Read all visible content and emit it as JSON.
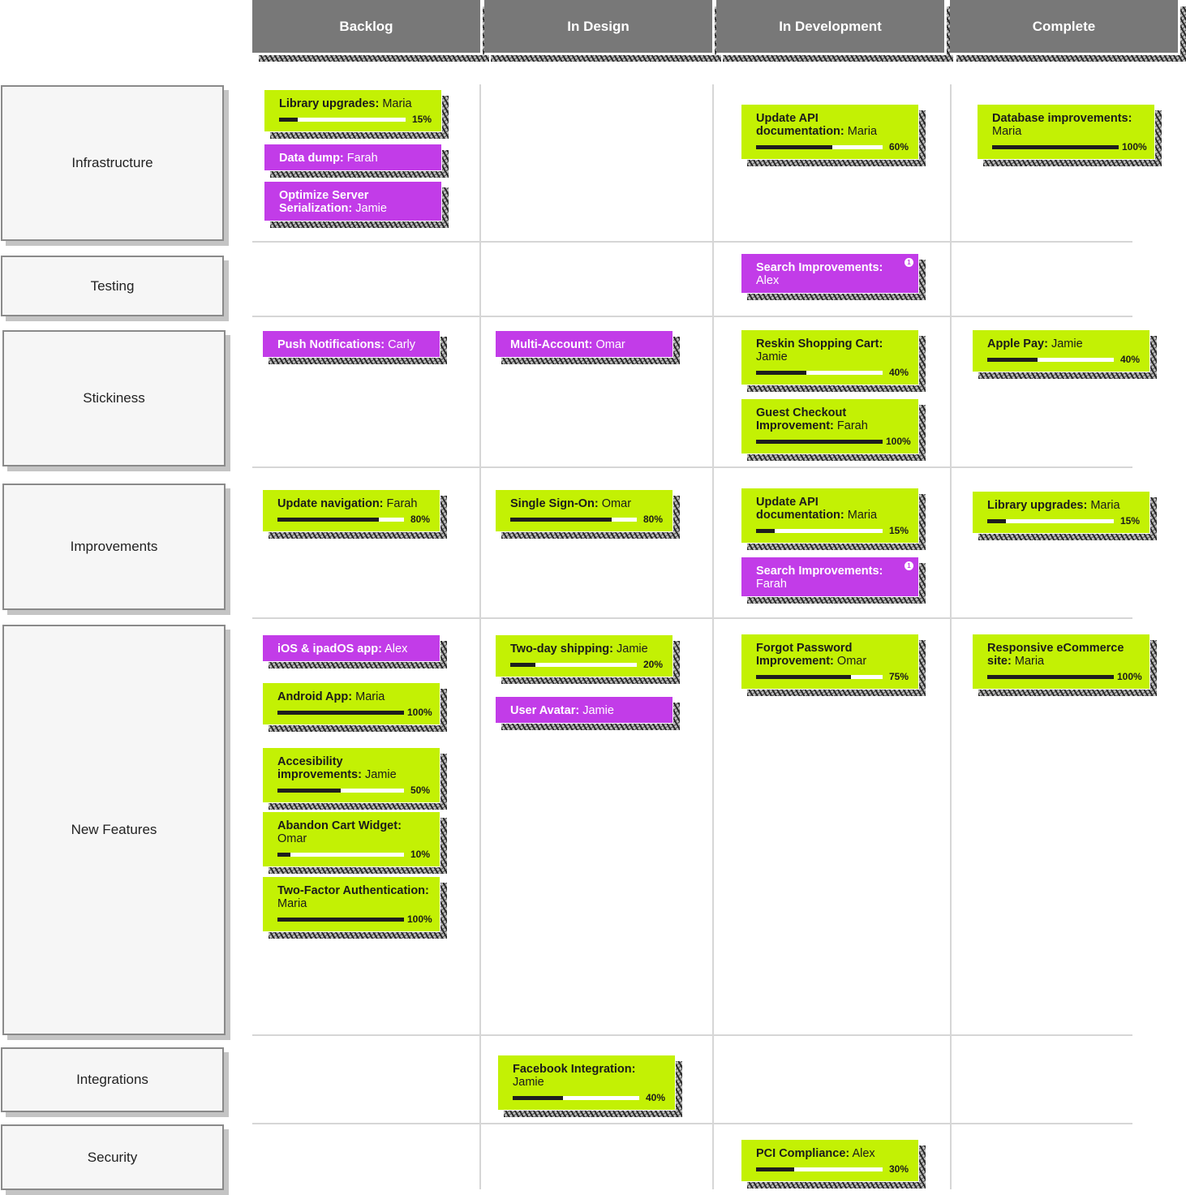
{
  "columns": [
    {
      "label": "Backlog"
    },
    {
      "label": "In Design"
    },
    {
      "label": "In Development"
    },
    {
      "label": "Complete"
    }
  ],
  "rows": [
    {
      "label": "Infrastructure"
    },
    {
      "label": "Testing"
    },
    {
      "label": "Stickiness"
    },
    {
      "label": "Improvements"
    },
    {
      "label": "New Features"
    },
    {
      "label": "Integrations"
    },
    {
      "label": "Security"
    }
  ],
  "colors": {
    "header": "#787878",
    "card_green": "#c3f104",
    "card_purple": "#c23ce8",
    "progress_fill": "#1e1e1e",
    "row_label_bg": "#f6f6f6",
    "grid_line": "#d6d6d6"
  },
  "cards": [
    {
      "row": "Infrastructure",
      "column": "Backlog",
      "title": "Library upgrades:",
      "owner": "Maria",
      "color": "green",
      "progress": 15,
      "progress_label": "15%"
    },
    {
      "row": "Infrastructure",
      "column": "Backlog",
      "title": "Data dump:",
      "owner": "Farah",
      "color": "purple"
    },
    {
      "row": "Infrastructure",
      "column": "Backlog",
      "title": "Optimize Server Serialization:",
      "owner": "Jamie",
      "color": "purple"
    },
    {
      "row": "Infrastructure",
      "column": "In Development",
      "title": "Update API documentation:",
      "owner": "Maria",
      "color": "green",
      "progress": 60,
      "progress_label": "60%"
    },
    {
      "row": "Infrastructure",
      "column": "Complete",
      "title": "Database improvements:",
      "owner": "Maria",
      "color": "green",
      "progress": 100,
      "progress_label": "100%"
    },
    {
      "row": "Testing",
      "column": "In Development",
      "title": "Search Improvements:",
      "owner": "Alex",
      "color": "purple",
      "badge": "1",
      "badge_icon": "info-icon"
    },
    {
      "row": "Stickiness",
      "column": "Backlog",
      "title": "Push Notifications:",
      "owner": "Carly",
      "color": "purple"
    },
    {
      "row": "Stickiness",
      "column": "In Design",
      "title": "Multi-Account:",
      "owner": "Omar",
      "color": "purple"
    },
    {
      "row": "Stickiness",
      "column": "In Development",
      "title": "Reskin Shopping Cart:",
      "owner": "Jamie",
      "color": "green",
      "progress": 40,
      "progress_label": "40%"
    },
    {
      "row": "Stickiness",
      "column": "In Development",
      "title": "Guest Checkout Improvement:",
      "owner": "Farah",
      "color": "green",
      "progress": 100,
      "progress_label": "100%"
    },
    {
      "row": "Stickiness",
      "column": "Complete",
      "title": "Apple Pay:",
      "owner": "Jamie",
      "color": "green",
      "progress": 40,
      "progress_label": "40%"
    },
    {
      "row": "Improvements",
      "column": "Backlog",
      "title": "Update navigation:",
      "owner": "Farah",
      "color": "green",
      "progress": 80,
      "progress_label": "80%"
    },
    {
      "row": "Improvements",
      "column": "In Design",
      "title": "Single Sign-On:",
      "owner": "Omar",
      "color": "green",
      "progress": 80,
      "progress_label": "80%"
    },
    {
      "row": "Improvements",
      "column": "In Development",
      "title": "Update API documentation:",
      "owner": "Maria",
      "color": "green",
      "progress": 15,
      "progress_label": "15%"
    },
    {
      "row": "Improvements",
      "column": "In Development",
      "title": "Search Improvements:",
      "owner": "Farah",
      "color": "purple",
      "badge": "1",
      "badge_icon": "info-icon"
    },
    {
      "row": "Improvements",
      "column": "Complete",
      "title": "Library upgrades:",
      "owner": "Maria",
      "color": "green",
      "progress": 15,
      "progress_label": "15%"
    },
    {
      "row": "New Features",
      "column": "Backlog",
      "title": "iOS & ipadOS app:",
      "owner": "Alex",
      "color": "purple"
    },
    {
      "row": "New Features",
      "column": "Backlog",
      "title": "Android App:",
      "owner": "Maria",
      "color": "green",
      "progress": 100,
      "progress_label": "100%"
    },
    {
      "row": "New Features",
      "column": "Backlog",
      "title": "Accesibility improvements:",
      "owner": "Jamie",
      "color": "green",
      "progress": 50,
      "progress_label": "50%"
    },
    {
      "row": "New Features",
      "column": "Backlog",
      "title": "Abandon Cart Widget:",
      "owner": "Omar",
      "color": "green",
      "progress": 10,
      "progress_label": "10%"
    },
    {
      "row": "New Features",
      "column": "Backlog",
      "title": "Two-Factor Authentication:",
      "owner": "Maria",
      "color": "green",
      "progress": 100,
      "progress_label": "100%"
    },
    {
      "row": "New Features",
      "column": "In Design",
      "title": "Two-day shipping:",
      "owner": "Jamie",
      "color": "green",
      "progress": 20,
      "progress_label": "20%"
    },
    {
      "row": "New Features",
      "column": "In Design",
      "title": "User Avatar:",
      "owner": "Jamie",
      "color": "purple"
    },
    {
      "row": "New Features",
      "column": "In Development",
      "title": "Forgot Password Improvement:",
      "owner": "Omar",
      "color": "green",
      "progress": 75,
      "progress_label": "75%"
    },
    {
      "row": "New Features",
      "column": "Complete",
      "title": "Responsive eCommerce site:",
      "owner": "Maria",
      "color": "green",
      "progress": 100,
      "progress_label": "100%"
    },
    {
      "row": "Integrations",
      "column": "In Design",
      "title": "Facebook Integration:",
      "owner": "Jamie",
      "color": "green",
      "progress": 40,
      "progress_label": "40%"
    },
    {
      "row": "Security",
      "column": "In Development",
      "title": "PCI Compliance:",
      "owner": "Alex",
      "color": "green",
      "progress": 30,
      "progress_label": "30%"
    }
  ]
}
